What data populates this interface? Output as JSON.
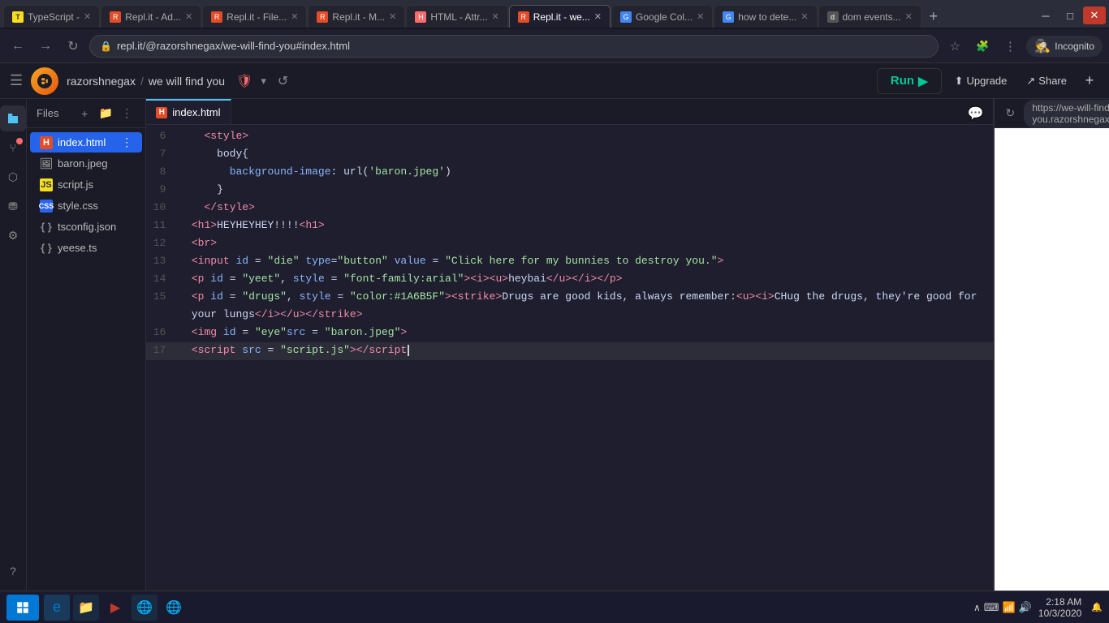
{
  "browser": {
    "tabs": [
      {
        "id": "tab1",
        "favicon_color": "#f7df1e",
        "favicon_letter": "T",
        "label": "TypeScript -",
        "active": false
      },
      {
        "id": "tab2",
        "favicon_color": "#e34c26",
        "favicon_letter": "R",
        "label": "Repl.it - Ad...",
        "active": false
      },
      {
        "id": "tab3",
        "favicon_color": "#e34c26",
        "favicon_letter": "R",
        "label": "Repl.it - File...",
        "active": false
      },
      {
        "id": "tab4",
        "favicon_color": "#e34c26",
        "favicon_letter": "R",
        "label": "Repl.it - M...",
        "active": false
      },
      {
        "id": "tab5",
        "favicon_color": "#ff6b6b",
        "favicon_letter": "H",
        "label": "HTML - Attr...",
        "active": false
      },
      {
        "id": "tab6",
        "favicon_color": "#e34c26",
        "favicon_letter": "R",
        "label": "Repl.it - we...",
        "active": true
      },
      {
        "id": "tab7",
        "favicon_color": "#4285f4",
        "favicon_letter": "G",
        "label": "Google Col...",
        "active": false
      },
      {
        "id": "tab8",
        "favicon_color": "#4285f4",
        "favicon_letter": "G",
        "label": "how to dete...",
        "active": false
      },
      {
        "id": "tab9",
        "favicon_color": "#555",
        "favicon_letter": "d",
        "label": "dom events...",
        "active": false
      }
    ],
    "address": "repl.it/@razorshnegax/we-will-find-you#index.html",
    "incognito_label": "Incognito"
  },
  "replit": {
    "username": "razorshnegax",
    "repl_name": "we will find you",
    "run_label": "Run",
    "upgrade_label": "Upgrade",
    "share_label": "Share"
  },
  "files": {
    "title": "Files",
    "items": [
      {
        "name": "index.html",
        "type": "html",
        "active": true
      },
      {
        "name": "baron.jpeg",
        "type": "img"
      },
      {
        "name": "script.js",
        "type": "js"
      },
      {
        "name": "style.css",
        "type": "css"
      },
      {
        "name": "tsconfig.json",
        "type": "json"
      },
      {
        "name": "yeese.ts",
        "type": "ts"
      }
    ]
  },
  "editor": {
    "tab_label": "index.html",
    "lines": [
      {
        "num": "6",
        "content": "    <style>"
      },
      {
        "num": "7",
        "content": "      body{"
      },
      {
        "num": "8",
        "content": "        background-image: url('baron.jpeg')"
      },
      {
        "num": "9",
        "content": "      }"
      },
      {
        "num": "10",
        "content": "    </style>"
      },
      {
        "num": "11",
        "content": "  <h1>HEYHEYHEY!!!!</h1>"
      },
      {
        "num": "12",
        "content": "  <br>"
      },
      {
        "num": "13",
        "content": "  <input id = \"die\" type=\"button\" value = \"Click here for my bunnies to destroy you.\">"
      },
      {
        "num": "14",
        "content": "  <p id = \"yeet\", style = \"font-family:arial\"><i><u>heybai</u></i></p>"
      },
      {
        "num": "15",
        "content": "  <p id = \"drugs\", style = \"color:#1A6B5F\"><strike>Drugs are good kids, always remember:<u><i>CHug the drugs, they're good for your lungs</i></u></strike>"
      },
      {
        "num": "16",
        "content": "  <img id = \"eye\"src = \"baron.jpeg\">"
      },
      {
        "num": "17",
        "content": "  <script src = \"script.js\"></",
        "cursor": true
      }
    ]
  },
  "preview": {
    "url": "https://we-will-find-you.razorshnegax.repl.co"
  },
  "taskbar": {
    "time": "2:18 AM",
    "date": "10/3/2020"
  }
}
